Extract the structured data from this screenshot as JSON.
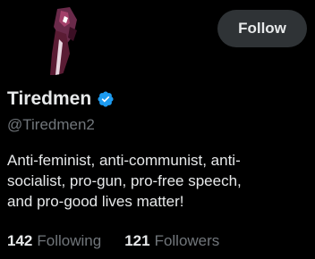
{
  "profile": {
    "display_name": "Tiredmen",
    "handle": "@Tiredmen2",
    "verified": true,
    "bio_lines": [
      "Anti-feminist, anti-communist, anti-",
      "socialist, pro-gun, pro-free speech,",
      "and pro-good lives matter!"
    ]
  },
  "actions": {
    "follow_label": "Follow"
  },
  "stats": {
    "following_count": "142",
    "following_label": "Following",
    "followers_count": "121",
    "followers_label": "Followers"
  },
  "icons": {
    "verified": "verified-badge-icon",
    "avatar": "avatar-image"
  },
  "colors": {
    "background": "#000000",
    "text_primary": "#e7e9ea",
    "text_secondary": "#71767b",
    "verified_blue": "#1d9bf0",
    "button_bg": "#2f3336"
  }
}
